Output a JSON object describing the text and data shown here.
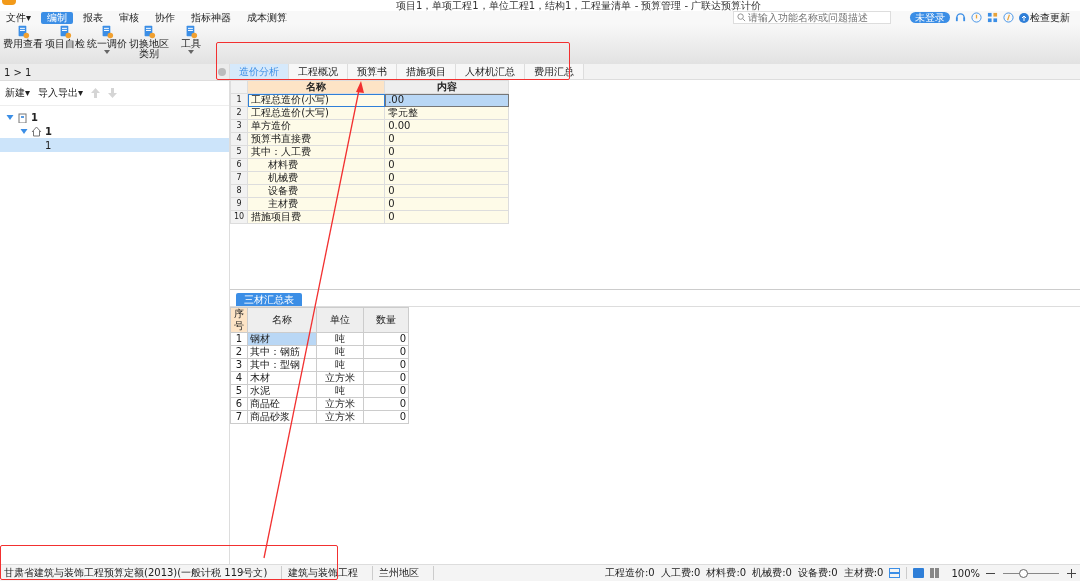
{
  "window": {
    "title": "项目1，单项工程1，单位工程1，结构1，工程量清单 - 预算管理 - 广联达预算计价"
  },
  "search": {
    "placeholder": "请输入功能名称或问题描述"
  },
  "login_button": "未登录",
  "update_button": "检查更新",
  "menu": [
    {
      "label": "文件▾",
      "selected": false
    },
    {
      "label": "编制",
      "selected": true
    },
    {
      "label": "报表",
      "selected": false
    },
    {
      "label": "审核",
      "selected": false
    },
    {
      "label": "协作",
      "selected": false
    },
    {
      "label": "指标神器",
      "selected": false
    },
    {
      "label": "成本测算",
      "selected": false
    }
  ],
  "ribbon": [
    {
      "label": "费用查看",
      "dropdown": false
    },
    {
      "label": "项目自检",
      "dropdown": false
    },
    {
      "label": "统一调价",
      "dropdown": true
    },
    {
      "label": "切换地区类别",
      "dropdown": false
    },
    {
      "label": "工具",
      "dropdown": true
    }
  ],
  "sidebar": {
    "breadcrumb": "1 > 1",
    "toolbar": [
      "新建▾",
      "导入导出▾"
    ],
    "tree": [
      {
        "label": "1",
        "kind": "building",
        "expanded": true,
        "selected": false,
        "children": [
          {
            "label": "1",
            "kind": "house",
            "expanded": true,
            "selected": false,
            "children": [
              {
                "label": "1",
                "kind": "file",
                "selected": true
              }
            ]
          }
        ]
      }
    ]
  },
  "tabs": [
    {
      "label": "造价分析",
      "selected": true
    },
    {
      "label": "工程概况",
      "selected": false
    },
    {
      "label": "预算书",
      "selected": false
    },
    {
      "label": "措施项目",
      "selected": false
    },
    {
      "label": "人材机汇总",
      "selected": false
    },
    {
      "label": "费用汇总",
      "selected": false
    }
  ],
  "grid": {
    "columns": [
      "名称",
      "内容"
    ],
    "rows": [
      {
        "no": "1",
        "name": "工程总造价(小写)",
        "value": ".00",
        "kind": "top",
        "selected": true
      },
      {
        "no": "2",
        "name": "工程总造价(大写)",
        "value": "零元整",
        "kind": "top",
        "selected": false
      },
      {
        "no": "3",
        "name": "单方造价",
        "value": "0.00",
        "kind": "top",
        "selected": false
      },
      {
        "no": "4",
        "name": "预算书直接费",
        "value": "0",
        "kind": "top",
        "selected": false
      },
      {
        "no": "5",
        "name": "其中：人工费",
        "value": "0",
        "kind": "top",
        "selected": false
      },
      {
        "no": "6",
        "name": "材料费",
        "value": "0",
        "kind": "sub",
        "selected": false
      },
      {
        "no": "7",
        "name": "机械费",
        "value": "0",
        "kind": "sub",
        "selected": false
      },
      {
        "no": "8",
        "name": "设备费",
        "value": "0",
        "kind": "sub",
        "selected": false
      },
      {
        "no": "9",
        "name": "主材费",
        "value": "0",
        "kind": "sub",
        "selected": false
      },
      {
        "no": "10",
        "name": "措施项目费",
        "value": "0",
        "kind": "top",
        "selected": false
      }
    ]
  },
  "materials": {
    "tab": "三材汇总表",
    "columns": [
      "序号",
      "名称",
      "单位",
      "数量"
    ],
    "rows": [
      {
        "no": "1",
        "name": "钢材",
        "unit": "吨",
        "qty": "0",
        "selected": true
      },
      {
        "no": "2",
        "name": "其中：钢筋",
        "unit": "吨",
        "qty": "0",
        "selected": false
      },
      {
        "no": "3",
        "name": "其中：型钢",
        "unit": "吨",
        "qty": "0",
        "selected": false
      },
      {
        "no": "4",
        "name": "木材",
        "unit": "立方米",
        "qty": "0",
        "selected": false
      },
      {
        "no": "5",
        "name": "水泥",
        "unit": "吨",
        "qty": "0",
        "selected": false
      },
      {
        "no": "6",
        "name": "商品砼",
        "unit": "立方米",
        "qty": "0",
        "selected": false
      },
      {
        "no": "7",
        "name": "商品砂浆",
        "unit": "立方米",
        "qty": "0",
        "selected": false
      }
    ]
  },
  "status_bar": {
    "left": [
      "甘肃省建筑与装饰工程预算定额(2013)(一般计税 119号文)",
      "建筑与装饰工程",
      "兰州地区"
    ],
    "totals": [
      "工程造价:0",
      "人工费:0",
      "材料费:0",
      "机械费:0",
      "设备费:0",
      "主材费:0"
    ],
    "zoom": "100%",
    "zoom_slider": {
      "level": 0.35
    }
  }
}
